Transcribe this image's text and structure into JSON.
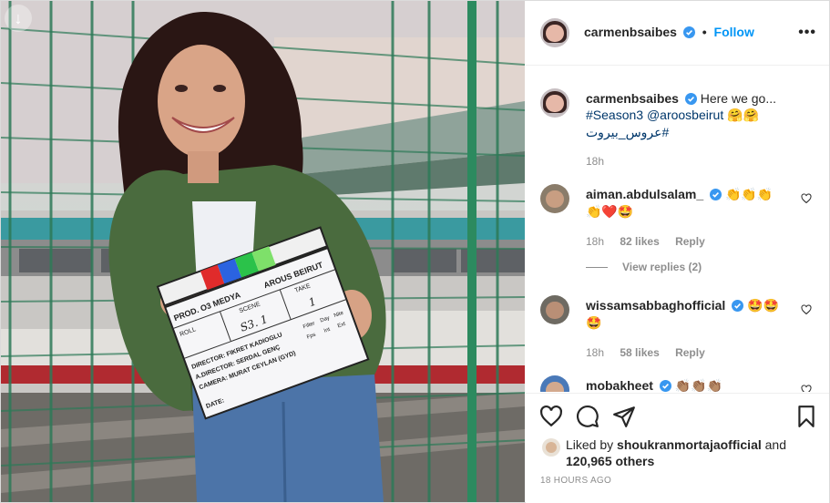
{
  "post": {
    "username": "carmenbsaibes",
    "follow_label": "Follow",
    "more_label": "•••",
    "separator": "•"
  },
  "caption": {
    "username": "carmenbsaibes",
    "text": "Here we go...",
    "hashtag1": "#Season3",
    "mention": "@aroosbeirut",
    "emoji": "🤗🤗",
    "hashtag2": "#عروس_بيروت",
    "time": "18h"
  },
  "comments": [
    {
      "username": "aiman.abdulsalam_",
      "text": "👏👏👏 👏❤️🤩",
      "time": "18h",
      "likes": "82 likes",
      "reply": "Reply",
      "view_replies": "View replies (2)"
    },
    {
      "username": "wissamsabbaghofficial",
      "text": "🤩🤩 🤩",
      "time": "18h",
      "likes": "58 likes",
      "reply": "Reply"
    },
    {
      "username": "mobakheet",
      "text": "👏🏽👏🏽👏🏽"
    }
  ],
  "likes": {
    "prefix": "Liked by",
    "user": "shoukranmortajaofficial",
    "and": "and",
    "count": "120,965 others"
  },
  "timestamp": "18 HOURS AGO",
  "clapper": {
    "prod": "PROD. O3 MEDYA",
    "title": "AROUS BEIRUT",
    "roll": "ROLL",
    "scene": "SCENE",
    "take": "TAKE",
    "scene_value": "S3. 1",
    "take_value": "1",
    "director": "DIRECTOR: FIKRET KADIOGLU",
    "asst": "A.DIRECTOR: SERDAL GENÇ",
    "camera": "CAMERA: MURAT CEYLAN (GYD)",
    "date": "DATE:",
    "filter": "Filter",
    "day": "Day",
    "nite": "Nite",
    "fps": "Fps",
    "int": "Int",
    "ext": "Ext"
  }
}
